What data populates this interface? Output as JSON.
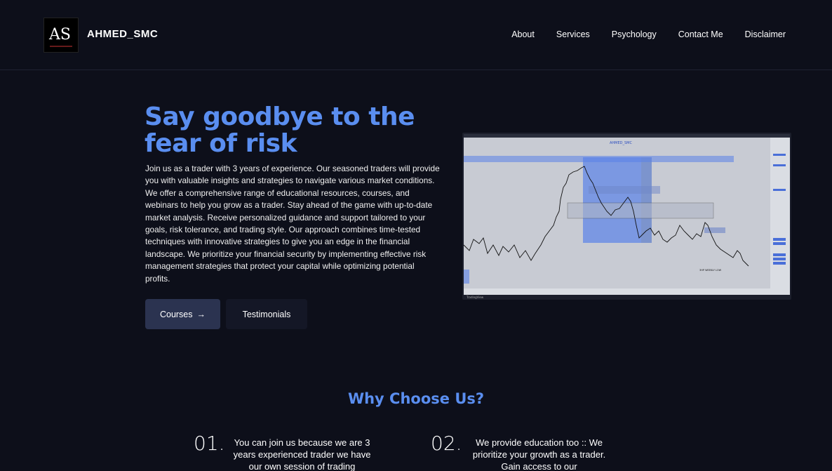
{
  "header": {
    "brand": "AHMED_SMC",
    "logo_text": "AS",
    "nav": [
      "About",
      "Services",
      "Psychology",
      "Contact Me",
      "Disclaimer"
    ]
  },
  "hero": {
    "title": "Say goodbye to the fear of risk",
    "description": "Join us as a trader with 3 years of experience. Our seasoned traders will provide you with valuable insights and strategies to navigate various market conditions. We offer a comprehensive range of educational resources, courses, and webinars to help you grow as a trader. Stay ahead of the game with up-to-date market analysis. Receive personalized guidance and support tailored to your goals, risk tolerance, and trading style. Our approach combines time-tested techniques with innovative strategies to give you an edge in the financial landscape. We prioritize your financial security by implementing effective risk management strategies that protect your capital while optimizing potential profits.",
    "primary_button": "Courses",
    "primary_button_icon": "arrow-right-icon",
    "secondary_button": "Testimonials"
  },
  "chart_image": {
    "watermark": "AHMED_SMC",
    "footer_label": "TradingView",
    "annotation_weekly_low": "3HP WEEKLY LOW"
  },
  "why": {
    "title": "Why Choose Us?",
    "items": [
      {
        "num": "01.",
        "text": "You can join us because we are 3 years experienced trader we have our own session of trading"
      },
      {
        "num": "02.",
        "text": "We provide education too :: We prioritize your growth as a trader. Gain access to our"
      }
    ]
  },
  "colors": {
    "background": "#0d0f1a",
    "accent": "#5a8ef0",
    "button_primary": "#2b3350",
    "button_secondary": "#141726"
  }
}
